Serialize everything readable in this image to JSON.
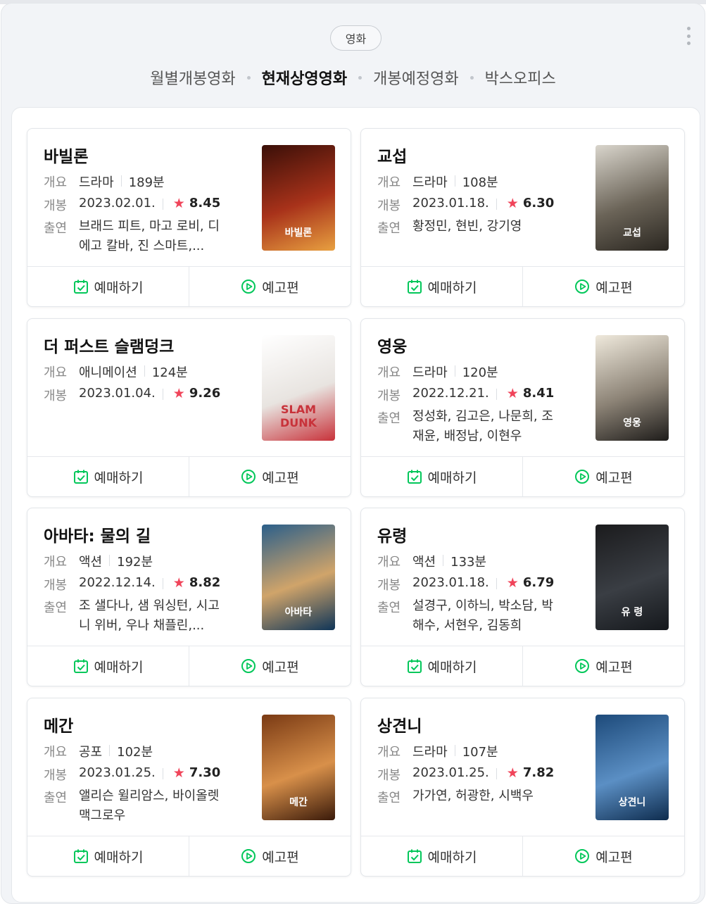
{
  "header": {
    "chip_label": "영화",
    "tabs": [
      "월별개봉영화",
      "현재상영영화",
      "개봉예정영화",
      "박스오피스"
    ],
    "active_tab": 1
  },
  "labels": {
    "summary": "개요",
    "release": "개봉",
    "cast": "출연",
    "book": "예매하기",
    "trailer": "예고편"
  },
  "colors": {
    "accent_green": "#03c75a",
    "star_red": "#f0445a"
  },
  "movies": [
    {
      "title": "바빌론",
      "genre": "드라마",
      "runtime": "189분",
      "release": "2023.02.01.",
      "rating": "8.45",
      "cast": "브래드 피트, 마고 로비, 디에고 칼바, 진 스마트,...",
      "poster_text": "바빌론",
      "poster_colors": [
        "#3a0f08",
        "#a8321a",
        "#e8a040"
      ]
    },
    {
      "title": "교섭",
      "genre": "드라마",
      "runtime": "108분",
      "release": "2023.01.18.",
      "rating": "6.30",
      "cast": "황정민, 현빈, 강기영",
      "poster_text": "교섭",
      "poster_colors": [
        "#d9d5cc",
        "#6b6458",
        "#2a2620"
      ]
    },
    {
      "title": "더 퍼스트 슬램덩크",
      "genre": "애니메이션",
      "runtime": "124분",
      "release": "2023.01.04.",
      "rating": "9.26",
      "cast": "",
      "poster_text": "SLAM DUNK",
      "poster_colors": [
        "#ffffff",
        "#e8e4e0",
        "#c8323a"
      ]
    },
    {
      "title": "영웅",
      "genre": "드라마",
      "runtime": "120분",
      "release": "2022.12.21.",
      "rating": "8.41",
      "cast": "정성화, 김고은, 나문희, 조재윤, 배정남, 이현우",
      "poster_text": "영웅",
      "poster_colors": [
        "#efe9dc",
        "#8c8376",
        "#1e1c1a"
      ]
    },
    {
      "title": "아바타: 물의 길",
      "genre": "액션",
      "runtime": "192분",
      "release": "2022.12.14.",
      "rating": "8.82",
      "cast": "조 샐다나, 샘 워싱턴, 시고니 위버, 우나 채플린,...",
      "poster_text": "아바타",
      "poster_colors": [
        "#2b5f8a",
        "#d0a46a",
        "#0f3558"
      ]
    },
    {
      "title": "유령",
      "genre": "액션",
      "runtime": "133분",
      "release": "2023.01.18.",
      "rating": "6.79",
      "cast": "설경구, 이하늬, 박소담, 박해수, 서현우, 김동희",
      "poster_text": "유 령",
      "poster_colors": [
        "#1b1b1d",
        "#3a3e44",
        "#15181c"
      ]
    },
    {
      "title": "메간",
      "genre": "공포",
      "runtime": "102분",
      "release": "2023.01.25.",
      "rating": "7.30",
      "cast": "앨리슨 윌리암스, 바이올렛 맥그로우",
      "poster_text": "메간",
      "poster_colors": [
        "#7a3a14",
        "#d8904a",
        "#3a1a0a"
      ]
    },
    {
      "title": "상견니",
      "genre": "드라마",
      "runtime": "107분",
      "release": "2023.01.25.",
      "rating": "7.82",
      "cast": "가가연, 허광한, 시백우",
      "poster_text": "상견니",
      "poster_colors": [
        "#1d4a7a",
        "#5b8fc4",
        "#0e2c4e"
      ]
    }
  ]
}
